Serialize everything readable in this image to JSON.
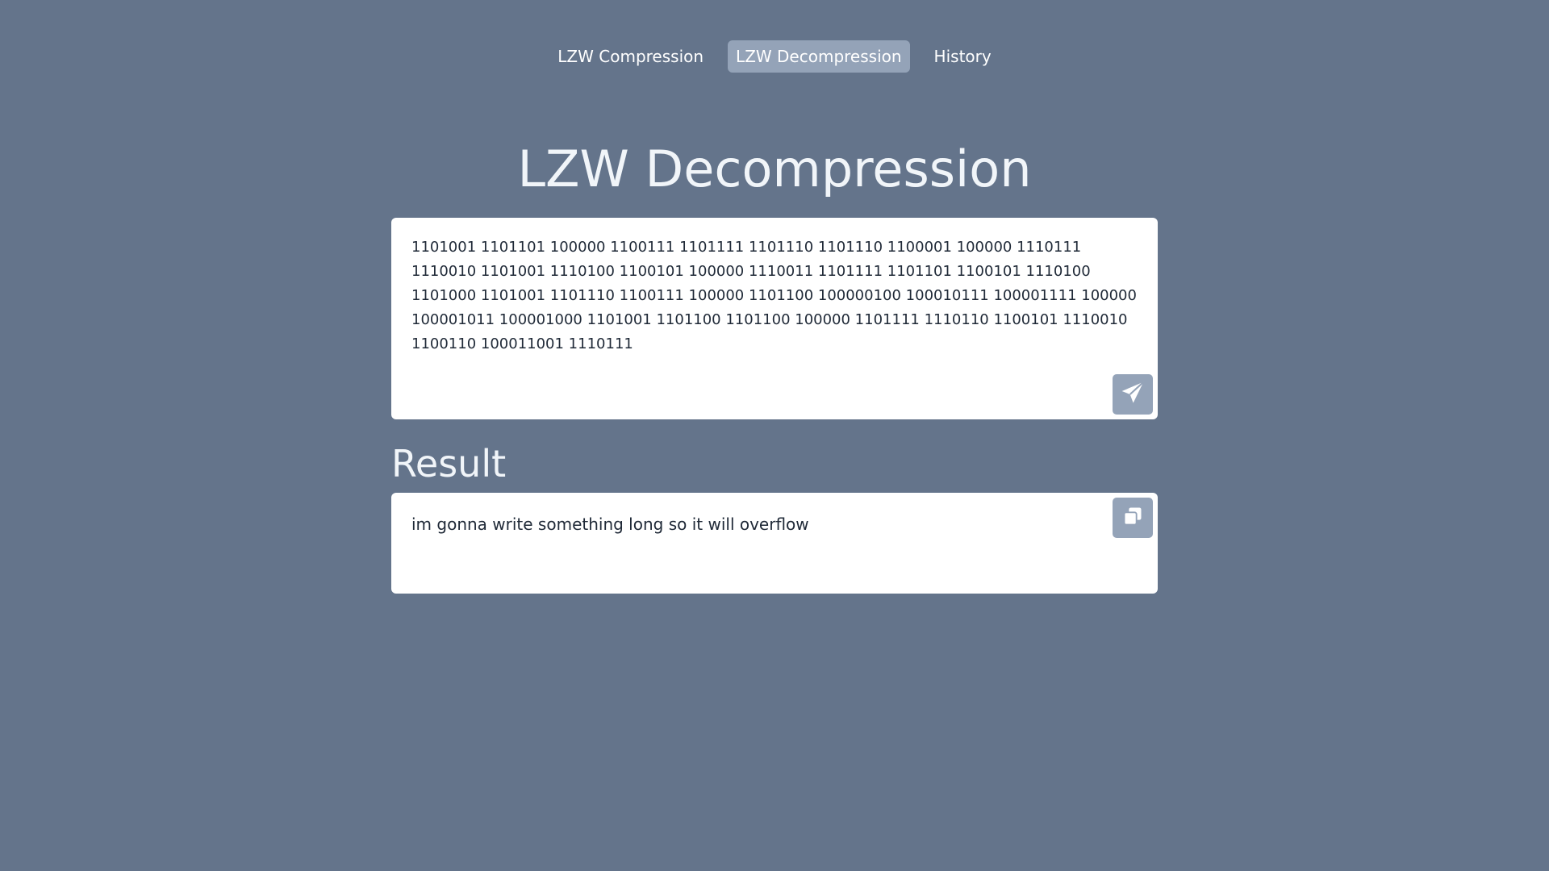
{
  "nav": {
    "items": [
      {
        "label": "LZW Compression",
        "active": false
      },
      {
        "label": "LZW Decompression",
        "active": true
      },
      {
        "label": "History",
        "active": false
      }
    ]
  },
  "main": {
    "title": "LZW Decompression",
    "input": {
      "value": "1101001 1101101 100000 1100111 1101111 1101110 1101110 1100001 100000 1110111 1110010 1101001 1110100 1100101 100000 1110011 1101111 1101101 1100101 1110100 1101000 1101001 1101110 1100111 100000 1101100 100000100 100010111 100001111 100000 100001011 100001000 1101001 1101100 1101100 100000 1101111 1110110 1100101 1110010 1100110 100011001 1110111",
      "submit_icon": "paper-plane-icon"
    },
    "result": {
      "heading": "Result",
      "text": "im gonna write something long so it will overflow",
      "copy_icon": "copy-icon"
    }
  },
  "colors": {
    "background": "#64748b",
    "accent": "#94a3b8",
    "card": "#ffffff"
  }
}
